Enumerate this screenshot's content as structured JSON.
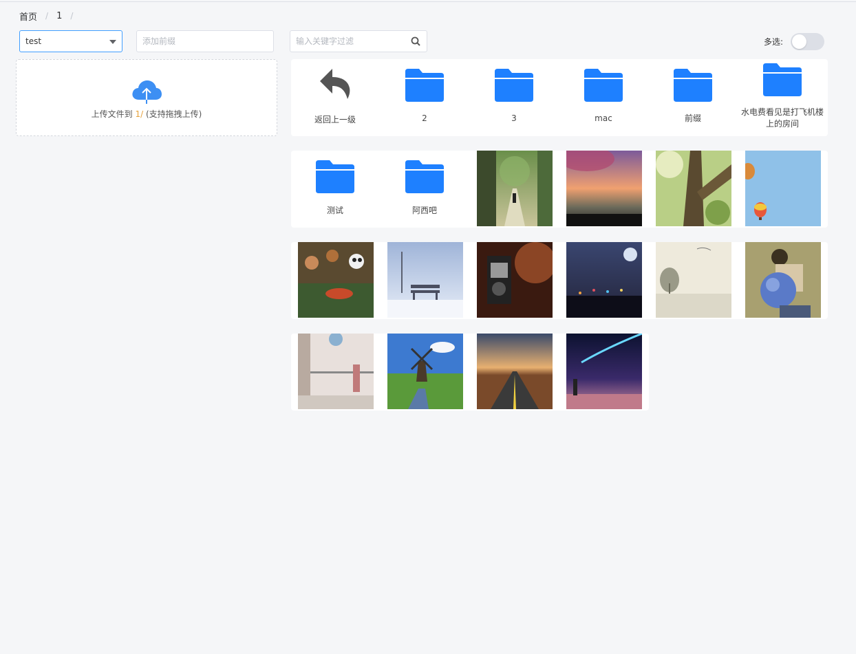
{
  "breadcrumb": {
    "items": [
      "首页",
      "1"
    ],
    "separator": "/"
  },
  "bucket_select": {
    "value": "test"
  },
  "prefix_input": {
    "placeholder": "添加前缀",
    "value": ""
  },
  "upload": {
    "text_before": "上传文件到 ",
    "path": "1/",
    "text_after": " (支持拖拽上传)"
  },
  "filter": {
    "placeholder": "输入关键字过滤",
    "value": ""
  },
  "multi_select": {
    "label": "多选:",
    "enabled": false
  },
  "accent_color": "#1e80ff",
  "back_item": {
    "label": "返回上一级",
    "icon": "back-arrow-icon"
  },
  "folders": [
    {
      "name": "2"
    },
    {
      "name": "3"
    },
    {
      "name": "mac"
    },
    {
      "name": "前缀"
    },
    {
      "name": "水电费看见是打飞机楼上的房间"
    },
    {
      "name": "测试"
    },
    {
      "name": "阿西吧"
    }
  ],
  "images": [
    {
      "subject": "forest-path"
    },
    {
      "subject": "sunset-blossoms"
    },
    {
      "subject": "tree-trunk"
    },
    {
      "subject": "hot-air-balloons"
    },
    {
      "subject": "crowded-party"
    },
    {
      "subject": "snowy-bench"
    },
    {
      "subject": "vintage-camera"
    },
    {
      "subject": "moon-city-night"
    },
    {
      "subject": "misty-landscape"
    },
    {
      "subject": "boy-with-globe"
    },
    {
      "subject": "balloon-balcony"
    },
    {
      "subject": "windmill-canal"
    },
    {
      "subject": "desert-road"
    },
    {
      "subject": "comet-sky"
    }
  ]
}
